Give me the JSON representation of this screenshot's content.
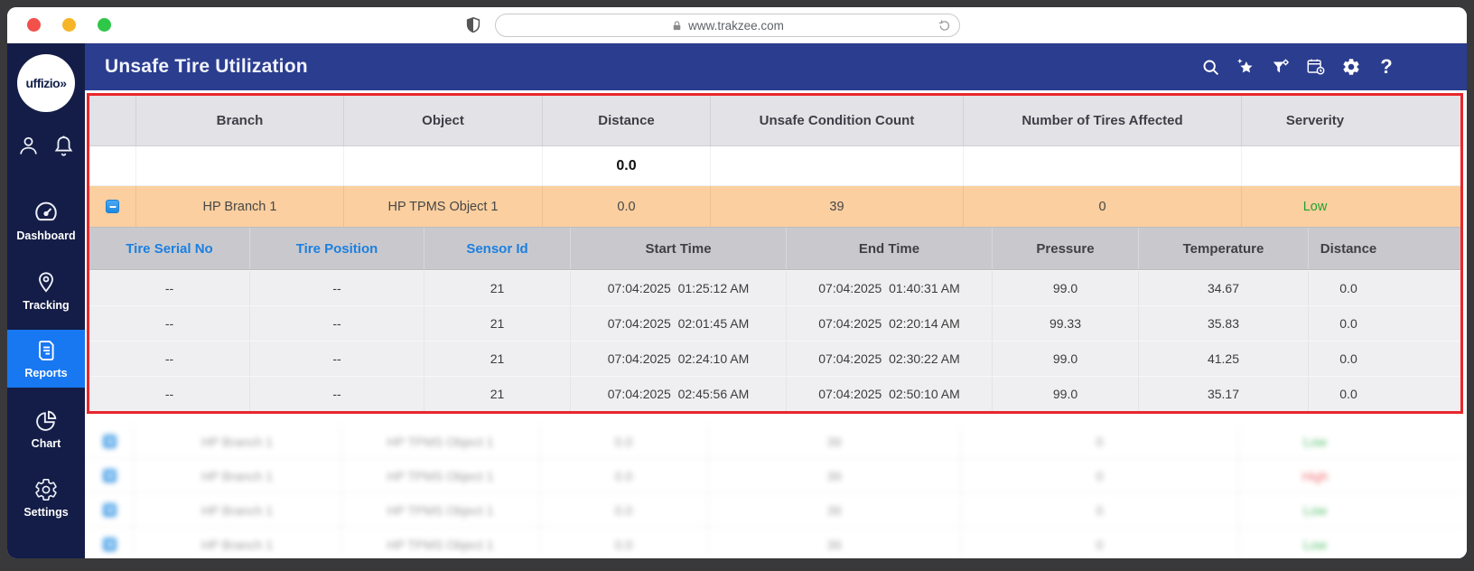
{
  "browser": {
    "url_text": "www.trakzee.com"
  },
  "topbar": {
    "title": "Unsafe Tire Utilization"
  },
  "sidebar": {
    "logo_text": "uffizio»",
    "items": [
      {
        "label": "Dashboard"
      },
      {
        "label": "Tracking"
      },
      {
        "label": "Reports"
      },
      {
        "label": "Chart"
      },
      {
        "label": "Settings"
      }
    ]
  },
  "colors": {
    "topbar_blue": "#2b3d8f",
    "sidebar_navy": "#141d47",
    "active_item_blue": "#1778f2",
    "group_row_orange": "#fbcf9f",
    "highlight_border_red": "#e8272c",
    "column_link_blue": "#1c7fe0",
    "severity_low_green": "#1fa32e",
    "severity_high_red": "#ef4d52"
  },
  "table": {
    "columns": [
      "Branch",
      "Object",
      "Distance",
      "Unsafe Condition Count",
      "Number of Tires Affected",
      "Serverity"
    ],
    "summary": {
      "distance": "0.0"
    },
    "group_row": {
      "branch": "HP Branch 1",
      "object": "HP TPMS Object 1",
      "distance": "0.0",
      "count": "39",
      "tires": "0",
      "severity": "Low",
      "severity_color": "#1fa32e"
    },
    "detail": {
      "columns": [
        "Tire Serial No",
        "Tire Position",
        "Sensor Id",
        "Start Time",
        "End Time",
        "Pressure",
        "Temperature",
        "Distance"
      ],
      "rows": [
        {
          "serial": "--",
          "position": "--",
          "sensor": "21",
          "start": "07:04:2025  01:25:12 AM",
          "end": "07:04:2025  01:40:31 AM",
          "pressure": "99.0",
          "temperature": "34.67",
          "distance": "0.0"
        },
        {
          "serial": "--",
          "position": "--",
          "sensor": "21",
          "start": "07:04:2025  02:01:45 AM",
          "end": "07:04:2025  02:20:14 AM",
          "pressure": "99.33",
          "temperature": "35.83",
          "distance": "0.0"
        },
        {
          "serial": "--",
          "position": "--",
          "sensor": "21",
          "start": "07:04:2025  02:24:10 AM",
          "end": "07:04:2025  02:30:22 AM",
          "pressure": "99.0",
          "temperature": "41.25",
          "distance": "0.0"
        },
        {
          "serial": "--",
          "position": "--",
          "sensor": "21",
          "start": "07:04:2025  02:45:56 AM",
          "end": "07:04:2025  02:50:10 AM",
          "pressure": "99.0",
          "temperature": "35.17",
          "distance": "0.0"
        }
      ]
    },
    "blurred_rows": [
      {
        "branch": "HP Branch 1",
        "object": "HP TPMS Object 1",
        "distance": "0.0",
        "count": "39",
        "tires": "0",
        "severity": "Low",
        "severity_color": "#2eb348"
      },
      {
        "branch": "HP Branch 1",
        "object": "HP TPMS Object 1",
        "distance": "0.0",
        "count": "39",
        "tires": "0",
        "severity": "High",
        "severity_color": "#ef4d52"
      },
      {
        "branch": "HP Branch 1",
        "object": "HP TPMS Object 1",
        "distance": "0.0",
        "count": "39",
        "tires": "0",
        "severity": "Low",
        "severity_color": "#2eb348"
      },
      {
        "branch": "HP Branch 1",
        "object": "HP TPMS Object 1",
        "distance": "0.0",
        "count": "39",
        "tires": "0",
        "severity": "Low",
        "severity_color": "#2eb348"
      }
    ]
  }
}
